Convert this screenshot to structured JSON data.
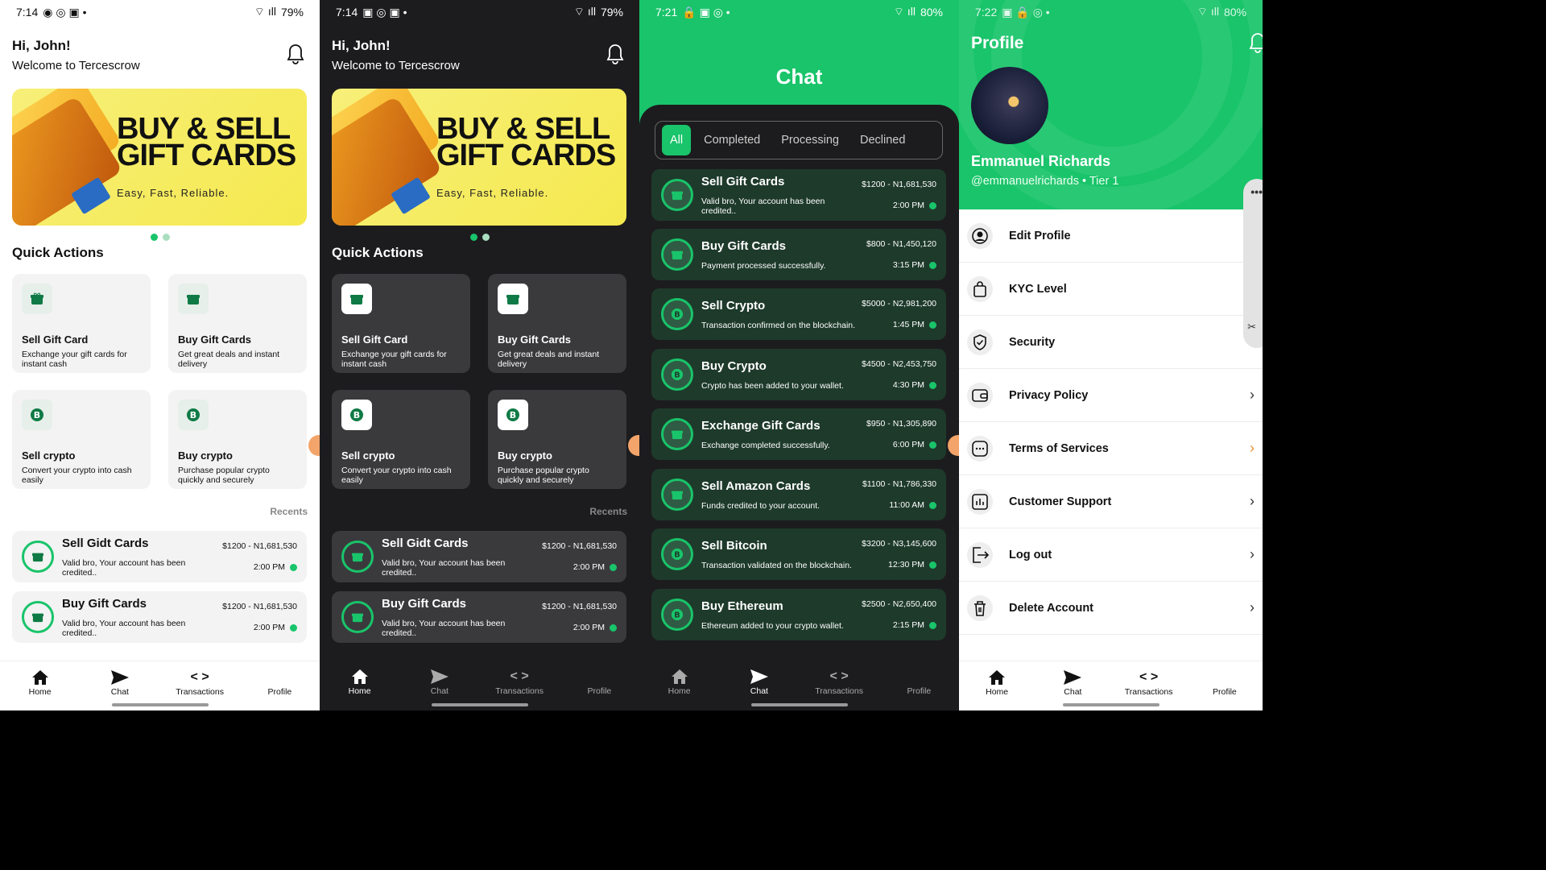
{
  "screens": {
    "s1": {
      "time": "7:14",
      "battery": "79%"
    },
    "s2": {
      "time": "7:14",
      "battery": "79%"
    },
    "s3": {
      "time": "7:21",
      "battery": "80%"
    },
    "s4": {
      "time": "7:22",
      "battery": "80%"
    }
  },
  "home": {
    "greeting": "Hi, John!",
    "welcome": "Welcome to Tercescrow",
    "banner_line1": "BUY & SELL",
    "banner_line2": "GIFT CARDS",
    "banner_tagline": "Easy, Fast, Reliable.",
    "quick_actions_title": "Quick Actions",
    "quick_actions": [
      {
        "title": "Sell Gift Card",
        "desc": "Exchange your gift cards for instant cash"
      },
      {
        "title": "Buy Gift Cards",
        "desc": "Get great deals and instant delivery"
      },
      {
        "title": "Sell crypto",
        "desc": "Convert your crypto into cash easily"
      },
      {
        "title": "Buy crypto",
        "desc": "Purchase popular crypto quickly and securely"
      }
    ],
    "recents_label": "Recents",
    "recents": [
      {
        "title": "Sell Gidt Cards",
        "amount": "$1200 - N1,681,530",
        "msg": "Valid bro, Your account has been credited..",
        "time": "2:00 PM"
      },
      {
        "title": "Buy Gift Cards",
        "amount": "$1200 - N1,681,530",
        "msg": "Valid bro, Your account has been credited..",
        "time": "2:00 PM"
      }
    ]
  },
  "chat": {
    "title": "Chat",
    "tabs": [
      "All",
      "Completed",
      "Processing",
      "Declined"
    ],
    "items": [
      {
        "title": "Sell Gift Cards",
        "amount": "$1200 - N1,681,530",
        "msg": "Valid bro, Your account has been credited..",
        "time": "2:00 PM"
      },
      {
        "title": "Buy Gift Cards",
        "amount": "$800 - N1,450,120",
        "msg": "Payment processed successfully.",
        "time": "3:15 PM"
      },
      {
        "title": "Sell Crypto",
        "amount": "$5000 - N2,981,200",
        "msg": "Transaction confirmed on the blockchain.",
        "time": "1:45 PM"
      },
      {
        "title": "Buy Crypto",
        "amount": "$4500 - N2,453,750",
        "msg": "Crypto has been added to your wallet.",
        "time": "4:30 PM"
      },
      {
        "title": "Exchange Gift Cards",
        "amount": "$950 - N1,305,890",
        "msg": "Exchange completed successfully.",
        "time": "6:00 PM"
      },
      {
        "title": "Sell Amazon Cards",
        "amount": "$1100 - N1,786,330",
        "msg": "Funds credited to your account.",
        "time": "11:00 AM"
      },
      {
        "title": "Sell Bitcoin",
        "amount": "$3200 - N3,145,600",
        "msg": "Transaction validated on the blockchain.",
        "time": "12:30 PM"
      },
      {
        "title": "Buy Ethereum",
        "amount": "$2500 - N2,650,400",
        "msg": "Ethereum added to your crypto wallet.",
        "time": "2:15 PM"
      }
    ]
  },
  "profile": {
    "title": "Profile",
    "name": "Emmanuel Richards",
    "handle": "@emmanuelrichards • Tier 1",
    "menu": [
      "Edit Profile",
      "KYC Level",
      "Security",
      "Privacy Policy",
      "Terms of Services",
      "Customer Support",
      "Log out",
      "Delete Account"
    ]
  },
  "nav": [
    "Home",
    "Chat",
    "Transactions",
    "Profile"
  ],
  "colors": {
    "accent": "#19c46a",
    "dark_bg": "#1c1c1e",
    "banner": "#f5e94f"
  }
}
